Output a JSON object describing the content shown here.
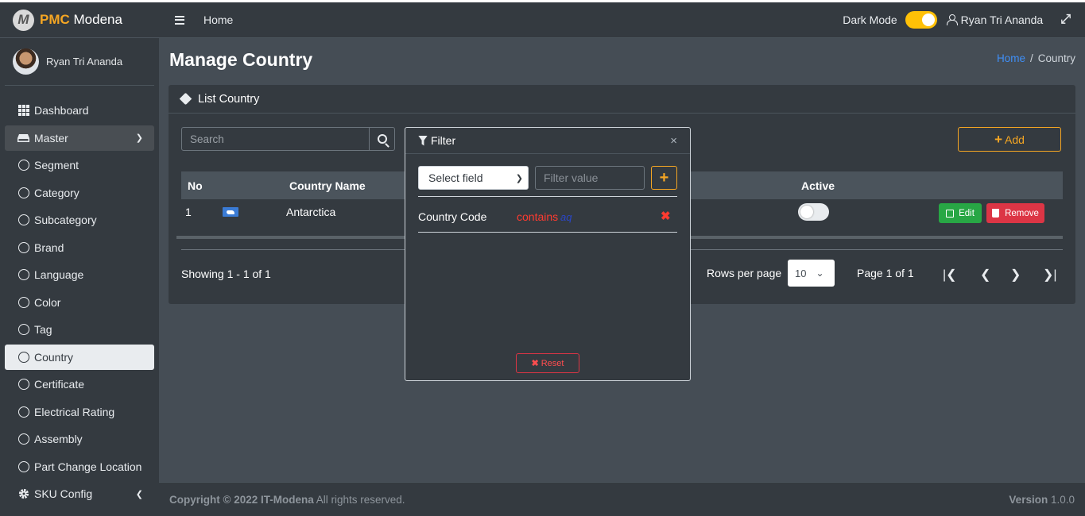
{
  "app": {
    "brand_bold": "PMC",
    "brand_rest": " Modena",
    "logo_letter": "M"
  },
  "user": {
    "name": "Ryan Tri Ananda"
  },
  "sidebar": {
    "items": [
      {
        "label": "Dashboard",
        "icon": "dashboard-grid-icon"
      },
      {
        "label": "Master",
        "icon": "hdd-icon",
        "state": "open"
      },
      {
        "label": "Segment",
        "icon": "circle-icon"
      },
      {
        "label": "Category",
        "icon": "circle-icon"
      },
      {
        "label": "Subcategory",
        "icon": "circle-icon"
      },
      {
        "label": "Brand",
        "icon": "circle-icon"
      },
      {
        "label": "Language",
        "icon": "circle-icon"
      },
      {
        "label": "Color",
        "icon": "circle-icon"
      },
      {
        "label": "Tag",
        "icon": "circle-icon"
      },
      {
        "label": "Country",
        "icon": "circle-icon",
        "state": "active"
      },
      {
        "label": "Certificate",
        "icon": "circle-icon"
      },
      {
        "label": "Electrical Rating",
        "icon": "circle-icon"
      },
      {
        "label": "Assembly",
        "icon": "circle-icon"
      },
      {
        "label": "Part Change Location",
        "icon": "circle-icon"
      },
      {
        "label": "SKU Config",
        "icon": "gear-icon"
      }
    ]
  },
  "header": {
    "home": "Home",
    "dark_mode": "Dark Mode",
    "dark_mode_on": true,
    "user": "Ryan Tri Ananda"
  },
  "page": {
    "title": "Manage Country",
    "breadcrumb_home": "Home",
    "breadcrumb_sep": "/",
    "breadcrumb_current": "Country"
  },
  "card": {
    "title": "List Country",
    "search_placeholder": "Search",
    "add_label": "Add",
    "columns": {
      "no": "No",
      "country_name": "Country Name",
      "active": "Active"
    },
    "rows": [
      {
        "no": "1",
        "name": "Antarctica",
        "active": false,
        "edit": "Edit",
        "remove": "Remove"
      }
    ],
    "showing": "Showing 1 - 1 of 1",
    "rows_per_page_label": "Rows per page",
    "rows_per_page": "10",
    "page_info": "Page 1 of 1"
  },
  "filter": {
    "title": "Filter",
    "close": "×",
    "select_placeholder": "Select field",
    "value_placeholder": "Filter value",
    "add": "+",
    "rules": [
      {
        "field": "Country Code",
        "operator": "contains",
        "value": "aq"
      }
    ],
    "reset": "Reset"
  },
  "footer": {
    "copyright_prefix": "Copyright © 2022",
    "company": "IT-Modena",
    "rights": " All rights reserved.",
    "version_label": "Version",
    "version": "1.0.0"
  },
  "colors": {
    "accent": "#f5a623",
    "sidebar": "#343a40",
    "content": "#454d55",
    "success": "#28a745",
    "danger": "#dc3545",
    "link": "#3f8ff7"
  }
}
